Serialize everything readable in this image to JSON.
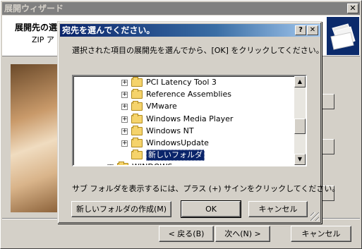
{
  "wizard": {
    "title": "展開ウィザード",
    "close_glyph": "✕",
    "header_title": "展開先の選",
    "header_sub": "ZIP ア",
    "back_label": "< 戻る(B)",
    "next_label": "次へ(N) >",
    "cancel_label": "キャンセル"
  },
  "dialog": {
    "title": "宛先を選んでください。",
    "help_glyph": "?",
    "close_glyph": "✕",
    "instruction": "選択された項目の展開先を選んでから、[OK] をクリックしてください。",
    "hint": "サブ フォルダを表示するには、プラス (+) サインをクリックしてください。",
    "new_folder_label": "新しいフォルダの作成(M)",
    "ok_label": "OK",
    "cancel_label": "キャンセル",
    "tree": [
      {
        "label": "PCI Latency Tool 3",
        "expander": "+",
        "level": 2
      },
      {
        "label": "Reference Assemblies",
        "expander": "+",
        "level": 2
      },
      {
        "label": "VMware",
        "expander": "+",
        "level": 2
      },
      {
        "label": "Windows Media Player",
        "expander": "+",
        "level": 2
      },
      {
        "label": "Windows NT",
        "expander": "+",
        "level": 2
      },
      {
        "label": "WindowsUpdate",
        "expander": "+",
        "level": 2
      },
      {
        "label": "新しいフォルダ",
        "expander": "",
        "level": 2,
        "selected": true
      },
      {
        "label": "WINDOWS",
        "expander": "+",
        "level": 1
      }
    ],
    "scroll_up_glyph": "▲",
    "scroll_down_glyph": "▼"
  }
}
